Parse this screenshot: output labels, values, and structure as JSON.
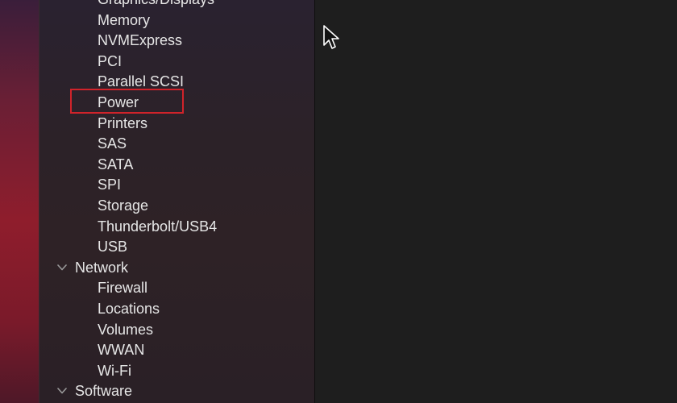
{
  "sidebar": {
    "hardware_items": [
      "Graphics/Displays",
      "Memory",
      "NVMExpress",
      "PCI",
      "Parallel SCSI",
      "Power",
      "Printers",
      "SAS",
      "SATA",
      "SPI",
      "Storage",
      "Thunderbolt/USB4",
      "USB"
    ],
    "network": {
      "label": "Network",
      "items": [
        "Firewall",
        "Locations",
        "Volumes",
        "WWAN",
        "Wi-Fi"
      ]
    },
    "software": {
      "label": "Software"
    },
    "highlighted_item": "Power",
    "highlight_color": "#d0232a"
  },
  "icons": {
    "group_toggle": "chevron-down-icon",
    "pointer": "mouse-cursor-icon"
  }
}
